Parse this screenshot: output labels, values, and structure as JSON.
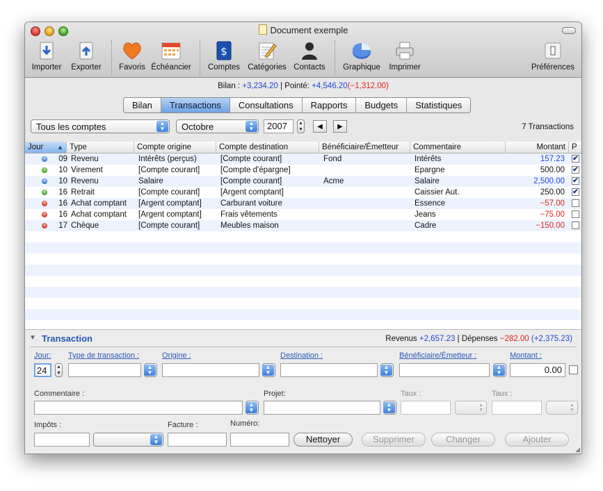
{
  "window": {
    "title": "Document exemple"
  },
  "toolbar": {
    "importer": "Importer",
    "exporter": "Exporter",
    "favoris": "Favoris",
    "echeancier": "Échéancier",
    "comptes": "Comptes",
    "categories": "Catégories",
    "contacts": "Contacts",
    "graphique": "Graphique",
    "imprimer": "Imprimer",
    "preferences": "Préférences"
  },
  "status": {
    "bilan_label": "Bilan :",
    "bilan_value": "+3,234.20",
    "sep": "|",
    "pointe_label": "Pointé:",
    "pointe_value": "+4,546.20",
    "pointe_diff": "(−1,312.00)"
  },
  "tabs": [
    "Bilan",
    "Transactions",
    "Consultations",
    "Rapports",
    "Budgets",
    "Statistiques"
  ],
  "filters": {
    "account": "Tous les comptes",
    "month": "Octobre",
    "year": "2007",
    "count": "7 Transactions"
  },
  "columns": {
    "jour": "Jour",
    "type": "Type",
    "origine": "Compte origine",
    "destination": "Compte destination",
    "beneficiaire": "Bénéficiaire/Émetteur",
    "commentaire": "Commentaire",
    "montant": "Montant",
    "p": "P"
  },
  "rows": [
    {
      "status": "blue",
      "jour": "09",
      "type": "Revenu",
      "origine": "Intérêts (perçus)",
      "destination": "[Compte courant]",
      "beneficiaire": "Fond",
      "commentaire": "Intérêts",
      "montant": "157.23",
      "montant_color": "#1f48d2",
      "pointe": true
    },
    {
      "status": "green",
      "jour": "10",
      "type": "Virement",
      "origine": "[Compte courant]",
      "destination": "[Compte d'épargne]",
      "beneficiaire": "",
      "commentaire": "Epargne",
      "montant": "500.00",
      "montant_color": "#111111",
      "pointe": true
    },
    {
      "status": "blue",
      "jour": "10",
      "type": "Revenu",
      "origine": "Salaire",
      "destination": "[Compte courant]",
      "beneficiaire": "Acme",
      "commentaire": "Salaire",
      "montant": "2,500.00",
      "montant_color": "#1f48d2",
      "pointe": true
    },
    {
      "status": "green",
      "jour": "16",
      "type": "Retrait",
      "origine": "[Compte courant]",
      "destination": "[Argent comptant]",
      "beneficiaire": "",
      "commentaire": "Caissier Aut.",
      "montant": "250.00",
      "montant_color": "#111111",
      "pointe": true
    },
    {
      "status": "red",
      "jour": "16",
      "type": "Achat comptant",
      "origine": "[Argent comptant]",
      "destination": "Carburant voiture",
      "beneficiaire": "",
      "commentaire": "Essence",
      "montant": "−57.00",
      "montant_color": "#e0231b",
      "pointe": false
    },
    {
      "status": "red",
      "jour": "16",
      "type": "Achat comptant",
      "origine": "[Argent comptant]",
      "destination": "Frais vêtements",
      "beneficiaire": "",
      "commentaire": "Jeans",
      "montant": "−75.00",
      "montant_color": "#e0231b",
      "pointe": false
    },
    {
      "status": "red",
      "jour": "17",
      "type": "Chèque",
      "origine": "[Compte courant]",
      "destination": "Meubles maison",
      "beneficiaire": "",
      "commentaire": "Cadre",
      "montant": "−150.00",
      "montant_color": "#e0231b",
      "pointe": false
    }
  ],
  "transaction": {
    "title": "Transaction",
    "revenus_label": "Revenus",
    "revenus_value": "+2,657.23",
    "sep": "|",
    "depenses_label": "Dépenses",
    "depenses_value": "−282.00",
    "net_value": "(+2,375.23)",
    "jour_label": "Jour:",
    "jour_value": "24",
    "type_label": "Type de transaction :",
    "origine_label": "Origine :",
    "destination_label": "Destination :",
    "beneficiaire_label": "Bénéficiaire/Émetteur :",
    "montant_label": "Montant :",
    "montant_value": "0.00",
    "commentaire_label": "Commentaire :",
    "projet_label": "Projet:",
    "taux1_label": "Taux :",
    "taux2_label": "Taux :",
    "impots_label": "Impôts :",
    "facture_label": "Facture :",
    "numero_label": "Numéro:",
    "nettoyer": "Nettoyer",
    "supprimer": "Supprimer",
    "changer": "Changer",
    "ajouter": "Ajouter"
  }
}
